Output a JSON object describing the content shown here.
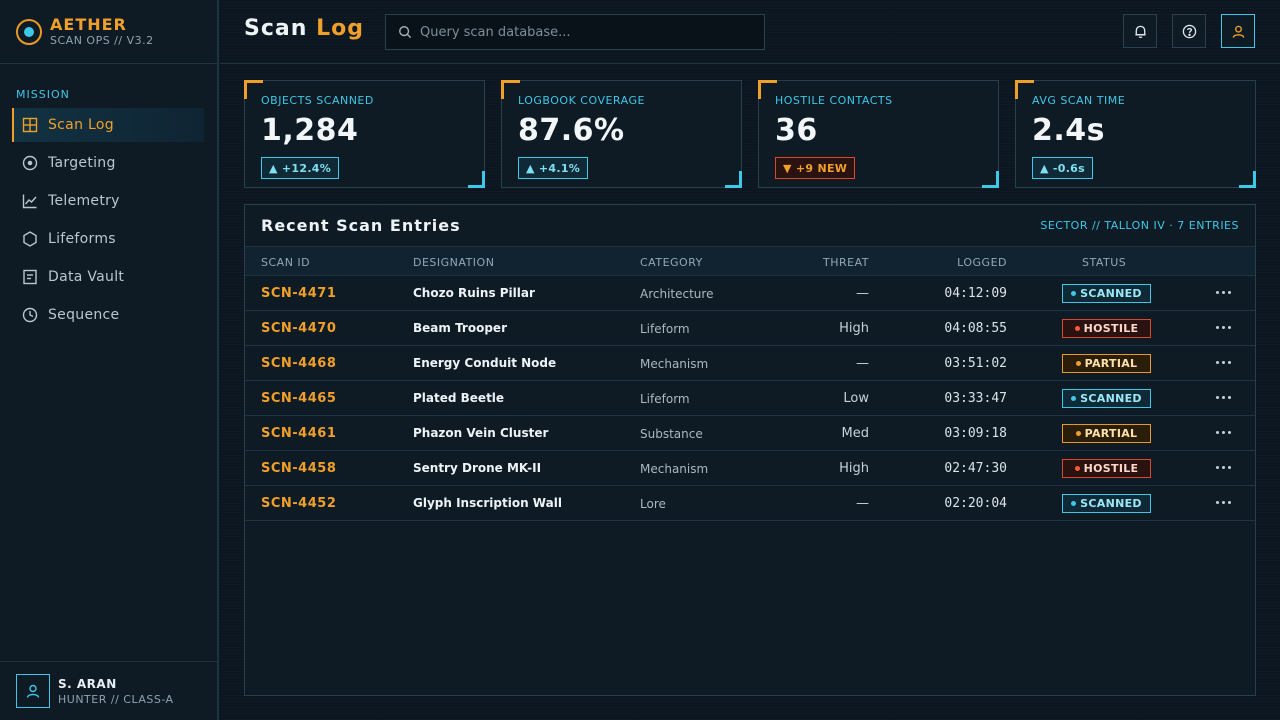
{
  "brand": {
    "name": "AETHER",
    "subtitle": "SCAN OPS // V3.2"
  },
  "sidebar": {
    "section_label": "MISSION",
    "items": [
      {
        "label": "Scan Log",
        "icon": "grid-icon",
        "active": true
      },
      {
        "label": "Targeting",
        "icon": "target-icon"
      },
      {
        "label": "Telemetry",
        "icon": "chart-line-icon"
      },
      {
        "label": "Lifeforms",
        "icon": "hexagon-icon"
      },
      {
        "label": "Data Vault",
        "icon": "document-icon"
      },
      {
        "label": "Sequence",
        "icon": "clock-icon"
      }
    ]
  },
  "user": {
    "name": "S. ARAN",
    "role": "HUNTER // CLASS-A"
  },
  "header": {
    "title_main": "Scan",
    "title_accent": "Log",
    "search_placeholder": "Query scan database..."
  },
  "stats": [
    {
      "label": "OBJECTS SCANNED",
      "value": "1,284",
      "badge": "▲ +12.4%",
      "badge_type": "up"
    },
    {
      "label": "LOGBOOK COVERAGE",
      "value": "87.6%",
      "badge": "▲ +4.1%",
      "badge_type": "up"
    },
    {
      "label": "HOSTILE CONTACTS",
      "value": "36",
      "badge": "▼ +9 NEW",
      "badge_type": "warn"
    },
    {
      "label": "AVG SCAN TIME",
      "value": "2.4s",
      "badge": "▲ -0.6s",
      "badge_type": "up"
    }
  ],
  "table": {
    "title": "Recent Scan Entries",
    "meta": "SECTOR // TALLON IV · 7 ENTRIES",
    "columns": {
      "id": "SCAN ID",
      "designation": "DESIGNATION",
      "category": "CATEGORY",
      "threat": "THREAT",
      "logged": "LOGGED",
      "status": "STATUS"
    },
    "rows": [
      {
        "id": "SCN-4471",
        "designation": "Chozo Ruins Pillar",
        "category": "Architecture",
        "threat": "—",
        "logged": "04:12:09",
        "status": "SCANNED",
        "status_type": "scanned"
      },
      {
        "id": "SCN-4470",
        "designation": "Beam Trooper",
        "category": "Lifeform",
        "threat": "High",
        "logged": "04:08:55",
        "status": "HOSTILE",
        "status_type": "hostile"
      },
      {
        "id": "SCN-4468",
        "designation": "Energy Conduit Node",
        "category": "Mechanism",
        "threat": "—",
        "logged": "03:51:02",
        "status": "PARTIAL",
        "status_type": "partial"
      },
      {
        "id": "SCN-4465",
        "designation": "Plated Beetle",
        "category": "Lifeform",
        "threat": "Low",
        "logged": "03:33:47",
        "status": "SCANNED",
        "status_type": "scanned"
      },
      {
        "id": "SCN-4461",
        "designation": "Phazon Vein Cluster",
        "category": "Substance",
        "threat": "Med",
        "logged": "03:09:18",
        "status": "PARTIAL",
        "status_type": "partial"
      },
      {
        "id": "SCN-4458",
        "designation": "Sentry Drone MK-II",
        "category": "Mechanism",
        "threat": "High",
        "logged": "02:47:30",
        "status": "HOSTILE",
        "status_type": "hostile"
      },
      {
        "id": "SCN-4452",
        "designation": "Glyph Inscription Wall",
        "category": "Lore",
        "threat": "—",
        "logged": "02:20:04",
        "status": "SCANNED",
        "status_type": "scanned"
      }
    ]
  },
  "colors": {
    "accent": "#f0a02a",
    "cyan": "#3ec8e8",
    "danger": "#d9482e",
    "background": "#0c1620"
  }
}
